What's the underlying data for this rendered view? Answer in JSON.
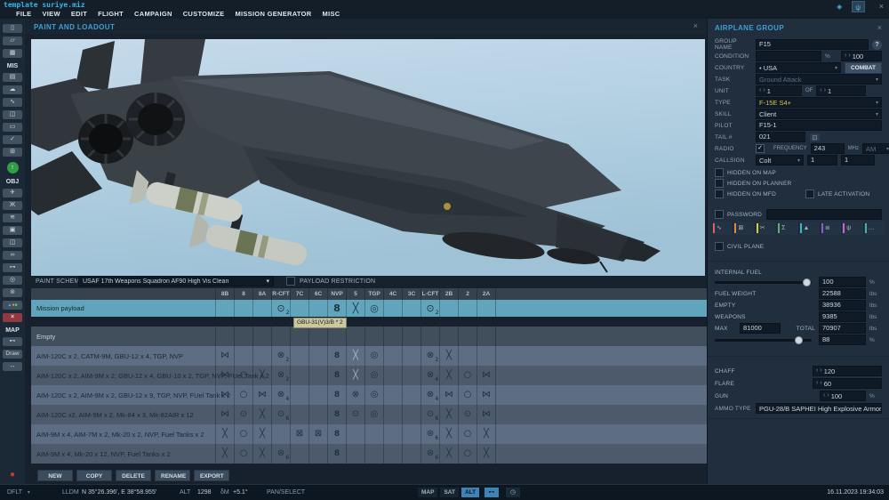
{
  "window": {
    "title": "template suriye.miz",
    "close": "×",
    "titlebar_icons": [
      {
        "name": "connection",
        "glyph": "◈",
        "active": false
      },
      {
        "name": "observer",
        "glyph": "ψ",
        "active": true
      }
    ]
  },
  "menu": [
    "FILE",
    "VIEW",
    "EDIT",
    "FLIGHT",
    "CAMPAIGN",
    "CUSTOMIZE",
    "MISSION GENERATOR",
    "MISC"
  ],
  "sidebar": {
    "items": [
      {
        "type": "btn",
        "name": "new-mission",
        "glyph": "▯"
      },
      {
        "type": "btn",
        "name": "open-mission",
        "glyph": "▱"
      },
      {
        "type": "btn",
        "name": "save-mission",
        "glyph": "▦"
      },
      {
        "type": "label",
        "name": "section-mis",
        "text": "MIS"
      },
      {
        "type": "btn",
        "name": "briefing",
        "glyph": "▤"
      },
      {
        "type": "btn",
        "name": "weather",
        "glyph": "☁"
      },
      {
        "type": "btn",
        "name": "route-tool",
        "glyph": "∿"
      },
      {
        "type": "btn",
        "name": "triggers",
        "glyph": "◫"
      },
      {
        "type": "btn",
        "name": "trigger-rules",
        "glyph": "▭"
      },
      {
        "type": "btn",
        "name": "goals",
        "glyph": "✓"
      },
      {
        "type": "btn",
        "name": "mission-generator",
        "glyph": "⊞"
      },
      {
        "type": "green",
        "name": "start-mission",
        "glyph": "↑"
      },
      {
        "type": "label",
        "name": "section-obj",
        "text": "OBJ"
      },
      {
        "type": "btn",
        "name": "add-airplane",
        "glyph": "✈"
      },
      {
        "type": "btn",
        "name": "add-helicopter",
        "glyph": "Ж"
      },
      {
        "type": "btn",
        "name": "add-ship",
        "glyph": "≋"
      },
      {
        "type": "btn",
        "name": "add-vehicle",
        "glyph": "▣"
      },
      {
        "type": "btn",
        "name": "add-static",
        "glyph": "◫"
      },
      {
        "type": "btn",
        "name": "add-group",
        "glyph": "∞"
      },
      {
        "type": "btn",
        "name": "add-point",
        "glyph": "⊶"
      },
      {
        "type": "btn",
        "name": "add-zone",
        "glyph": "◎"
      },
      {
        "type": "btn",
        "name": "add-template",
        "glyph": "⊚"
      },
      {
        "type": "multicolor",
        "name": "airfields"
      },
      {
        "type": "red",
        "name": "delete-object",
        "glyph": "×"
      },
      {
        "type": "label",
        "name": "section-map",
        "text": "MAP"
      },
      {
        "type": "btn",
        "name": "map-options",
        "glyph": "⊷"
      },
      {
        "type": "btntext",
        "name": "draw-tool",
        "text": "Draw"
      },
      {
        "type": "btn",
        "name": "measure-tool",
        "glyph": "↔"
      },
      {
        "type": "record",
        "name": "record",
        "glyph": "●"
      }
    ]
  },
  "loadout": {
    "title": "PAINT AND LOADOUT",
    "close": "×",
    "paint_scheme_label": "PAINT SCHEME",
    "paint_scheme": "USAF 17th Weapons Squadron AF90 High Vis Clean",
    "payload_restriction_label": "PAYLOAD RESTRICTION",
    "columns": [
      "8B",
      "8",
      "8A",
      "R-CFT",
      "7C",
      "6C",
      "NVP",
      "5",
      "TGP",
      "4C",
      "3C",
      "L-CFT",
      "2B",
      "2",
      "2A"
    ],
    "icon_glyphs": {
      "xframe": "⋈",
      "circle": "○",
      "circledot": "⊙",
      "x": "╳",
      "xlight": "╳",
      "bomb": "⊙",
      "bombx": "⊗",
      "pod": "8",
      "ring": "◎",
      "clock": "⊛",
      "xbox": "⊠"
    },
    "tooltip": "GBU-31(V)3/B * 2",
    "mission_row": {
      "label": "Mission payload",
      "cells": [
        [
          "R-CFT",
          "bomb",
          "2"
        ],
        [
          "NVP",
          "pod",
          ""
        ],
        [
          "5",
          "xlight",
          ""
        ],
        [
          "TGP",
          "ring",
          ""
        ],
        [
          "L-CFT",
          "bomb",
          "2"
        ]
      ]
    },
    "presets": [
      {
        "label": "Empty",
        "cells": []
      },
      {
        "label": "AIM-120C x 2, CATM-9M, GBU-12 x 4,  TGP, NVP",
        "cells": [
          [
            "8B",
            "xframe",
            ""
          ],
          [
            "R-CFT",
            "bombx",
            "2"
          ],
          [
            "NVP",
            "pod",
            ""
          ],
          [
            "5",
            "xlight",
            ""
          ],
          [
            "TGP",
            "ring",
            ""
          ],
          [
            "L-CFT",
            "bombx",
            "2"
          ],
          [
            "2B",
            "x",
            ""
          ]
        ]
      },
      {
        "label": "AIM-120C x 2, AIM-9M x 2, GBU-12 x 4, GBU-10 x 2, TGP, NVP, FUel Tank x 2",
        "cells": [
          [
            "8B",
            "xframe",
            ""
          ],
          [
            "8",
            "circle",
            ""
          ],
          [
            "8A",
            "x",
            ""
          ],
          [
            "R-CFT",
            "bombx",
            "2"
          ],
          [
            "NVP",
            "pod",
            ""
          ],
          [
            "5",
            "xlight",
            ""
          ],
          [
            "TGP",
            "ring",
            ""
          ],
          [
            "L-CFT",
            "bombx",
            "4"
          ],
          [
            "2B",
            "x",
            ""
          ],
          [
            "2",
            "circle",
            ""
          ],
          [
            "2A",
            "xframe",
            ""
          ]
        ]
      },
      {
        "label": "AIM-120C x 2, AIM-9M x 2, GBU-12 x 9, TGP, NVP, FUel Tank x 2",
        "cells": [
          [
            "8B",
            "xframe",
            ""
          ],
          [
            "8",
            "circle",
            ""
          ],
          [
            "8A",
            "xframe",
            ""
          ],
          [
            "R-CFT",
            "bombx",
            "4"
          ],
          [
            "NVP",
            "pod",
            ""
          ],
          [
            "5",
            "bombx",
            ""
          ],
          [
            "TGP",
            "ring",
            ""
          ],
          [
            "L-CFT",
            "bombx",
            "4"
          ],
          [
            "2B",
            "xframe",
            ""
          ],
          [
            "2",
            "circle",
            ""
          ],
          [
            "2A",
            "xframe",
            ""
          ]
        ]
      },
      {
        "label": "AIM-120C x2, AIM-9M x 2, Mk-84 x 3, Mk-82AIR x 12",
        "cells": [
          [
            "8B",
            "xframe",
            ""
          ],
          [
            "8",
            "circledot",
            ""
          ],
          [
            "8A",
            "x",
            ""
          ],
          [
            "R-CFT",
            "bomb",
            "6"
          ],
          [
            "NVP",
            "pod",
            ""
          ],
          [
            "5",
            "circledot",
            ""
          ],
          [
            "TGP",
            "ring",
            ""
          ],
          [
            "L-CFT",
            "bomb",
            "6"
          ],
          [
            "2B",
            "x",
            ""
          ],
          [
            "2",
            "circledot",
            ""
          ],
          [
            "2A",
            "xframe",
            ""
          ]
        ]
      },
      {
        "label": "AIM-9M x 4, AIM-7M x 2, Mk-20 x 2, NVP, Fuel Tanks x 2",
        "cells": [
          [
            "8B",
            "x",
            ""
          ],
          [
            "8",
            "circle",
            ""
          ],
          [
            "8A",
            "x",
            ""
          ],
          [
            "7C",
            "xbox",
            ""
          ],
          [
            "6C",
            "xbox",
            ""
          ],
          [
            "NVP",
            "pod",
            ""
          ],
          [
            "L-CFT",
            "clock",
            "6"
          ],
          [
            "2B",
            "x",
            ""
          ],
          [
            "2",
            "circle",
            ""
          ],
          [
            "2A",
            "x",
            ""
          ]
        ]
      },
      {
        "label": "AIM-9M x 4, Mk-20 x 12, NVP, Fuel Tanks x 2",
        "cells": [
          [
            "8B",
            "x",
            ""
          ],
          [
            "8",
            "circle",
            ""
          ],
          [
            "8A",
            "x",
            ""
          ],
          [
            "R-CFT",
            "clock",
            "6"
          ],
          [
            "NVP",
            "pod",
            ""
          ],
          [
            "L-CFT",
            "clock",
            "6"
          ],
          [
            "2B",
            "x",
            ""
          ],
          [
            "2",
            "circle",
            ""
          ],
          [
            "2A",
            "x",
            ""
          ]
        ]
      }
    ],
    "actions": [
      "NEW",
      "COPY",
      "DELETE",
      "RENAME",
      "EXPORT"
    ]
  },
  "group_panel": {
    "title": "AIRPLANE GROUP",
    "close": "×",
    "group_name_label": "GROUP NAME",
    "group_name": "F15",
    "help": "?",
    "condition_label": "CONDITION",
    "condition_value": "",
    "condition_unit": "%",
    "condition_spin": "100",
    "country_label": "COUNTRY",
    "country": "USA",
    "combat": "COMBAT",
    "task_label": "TASK",
    "task": "Ground Attack",
    "unit_label": "UNIT",
    "unit_count": "1",
    "of_label": "OF",
    "unit_of": "1",
    "type_label": "TYPE",
    "type": "F-15E S4+",
    "skill_label": "SKILL",
    "skill": "Client",
    "pilot_label": "PILOT",
    "pilot": "F15-1",
    "tail_label": "TAIL #",
    "tail": "021",
    "radio_label": "RADIO",
    "frequency_label": "FREQUENCY",
    "frequency": "243",
    "freq_unit": "MHz",
    "modulation": "AM",
    "callsign_label": "CALLSIGN",
    "callsign": "Colt",
    "callsign_num1": "1",
    "callsign_num2": "1",
    "hidden_map": "HIDDEN ON MAP",
    "hidden_planner": "HIDDEN ON PLANNER",
    "hidden_mfd": "HIDDEN ON MFD",
    "late_activation": "LATE ACTIVATION",
    "password_label": "PASSWORD",
    "action_icons": [
      {
        "name": "route",
        "color": "#e25d5d",
        "glyph": "∿"
      },
      {
        "name": "frame",
        "color": "#e08b3a",
        "glyph": "⊠"
      },
      {
        "name": "cut",
        "color": "#d9c93f",
        "glyph": "✂"
      },
      {
        "name": "summary",
        "color": "#54b65e",
        "glyph": "Σ"
      },
      {
        "name": "warning",
        "color": "#3fb5c9",
        "glyph": "▲"
      },
      {
        "name": "list",
        "color": "#8e5bc9",
        "glyph": "≣"
      },
      {
        "name": "antenna",
        "color": "#c468d8",
        "glyph": "ψ"
      },
      {
        "name": "more",
        "color": "#3fb5a6",
        "glyph": "…"
      }
    ],
    "civil_label": "CIVIL PLANE",
    "internal_fuel_label": "INTERNAL FUEL",
    "internal_fuel": "100",
    "pct": "%",
    "fuel_weight_label": "FUEL WEIGHT",
    "fuel_weight": "22588",
    "empty_label": "EMPTY",
    "empty_weight": "38936",
    "weapons_label": "WEAPONS",
    "weapons_weight": "9385",
    "max_label": "MAX",
    "max_weight": "81000",
    "total_label": "TOTAL",
    "total_weight": "70907",
    "lbs": "lbs",
    "load_pct": "88",
    "chaff_label": "CHAFF",
    "chaff": "120",
    "flare_label": "FLARE",
    "flare": "60",
    "gun_label": "GUN",
    "gun": "100",
    "ammo_label": "AMMO TYPE",
    "ammo": "PGU-28/B SAPHEI High Explosive Armor I"
  },
  "statusbar": {
    "mode": "DFLT",
    "format": "LLDM",
    "coords": "N 35°26.396', E 38°58.955'",
    "alt_label": "ALT",
    "alt": "1298",
    "dm_label": "δM",
    "dm": "+5.1°",
    "tool": "PAN/SELECT",
    "layers": [
      "MAP",
      "SAT",
      "ALT"
    ],
    "active_layer": "ALT",
    "icons": [
      {
        "name": "measure",
        "glyph": "⊷",
        "active": true
      },
      {
        "name": "clock",
        "glyph": "◷",
        "active": false
      }
    ],
    "datetime": "16.11.2023 19:34:03"
  }
}
